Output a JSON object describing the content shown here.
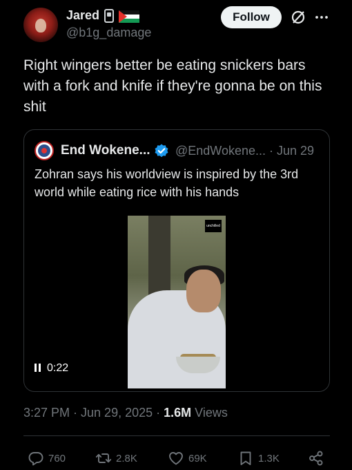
{
  "tweet": {
    "author_name": "Jared",
    "author_handle": "@b1g_damage",
    "follow_label": "Follow",
    "text": "Right wingers better be eating snickers bars with a fork and knife if they're gonna be on this shit",
    "time": "3:27 PM · Jun 29, 2025 · ",
    "views_count": "1.6M",
    "views_label": "Views"
  },
  "quote": {
    "author_name": "End Wokene...",
    "handle_and_date": "@EndWokene... · Jun 29",
    "text": "Zohran says his worldview is inspired by the 3rd world while eating rice with his hands",
    "video_duration": "0:22",
    "video_watermark": "unchilled"
  },
  "actions": {
    "replies": "760",
    "reposts": "2.8K",
    "likes": "69K",
    "bookmarks": "1.3K"
  },
  "icons": {
    "avatar": "avatar",
    "badge": "phone-icon",
    "flag": "palestine-flag-icon",
    "grok": "grok-icon",
    "more": "more-icon",
    "verified": "verified-icon",
    "pause": "pause-icon",
    "reply": "reply-icon",
    "retweet": "retweet-icon",
    "like": "heart-icon",
    "bookmark": "bookmark-icon",
    "share": "share-icon"
  },
  "colors": {
    "background": "#000000",
    "text_primary": "#e7e9ea",
    "text_secondary": "#71767b",
    "verified_blue": "#1d9bf0",
    "border": "#2f3336"
  }
}
